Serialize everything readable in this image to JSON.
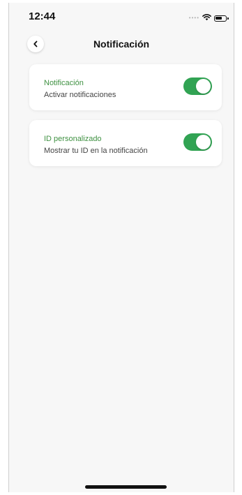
{
  "status_bar": {
    "time": "12:44",
    "signal_icon": "signal-dots-icon",
    "wifi_icon": "wifi-icon",
    "battery_icon": "battery-icon"
  },
  "header": {
    "back_icon": "chevron-left-icon",
    "title": "Notificación"
  },
  "settings": [
    {
      "title": "Notificación",
      "subtitle": "Activar notificaciones",
      "enabled": true
    },
    {
      "title": "ID personalizado",
      "subtitle": "Mostrar tu ID en la notificación",
      "enabled": true
    }
  ],
  "colors": {
    "accent": "#31a353",
    "title_text": "#3f9142",
    "background": "#f7f7f7"
  }
}
